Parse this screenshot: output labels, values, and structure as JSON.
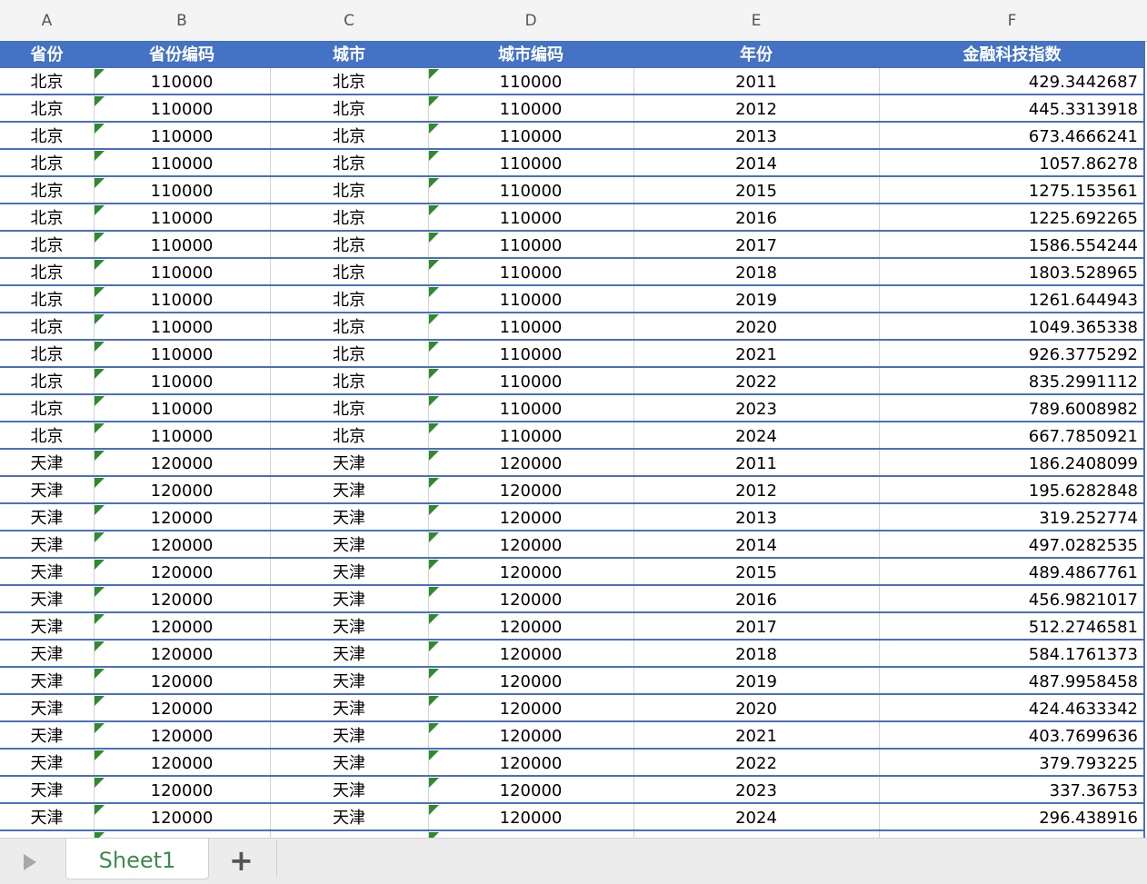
{
  "column_letters": [
    "A",
    "B",
    "C",
    "D",
    "E",
    "F"
  ],
  "headers": [
    "省份",
    "省份编码",
    "城市",
    "城市编码",
    "年份",
    "金融科技指数"
  ],
  "rows": [
    [
      "北京",
      "110000",
      "北京",
      "110000",
      "2011",
      "429.3442687"
    ],
    [
      "北京",
      "110000",
      "北京",
      "110000",
      "2012",
      "445.3313918"
    ],
    [
      "北京",
      "110000",
      "北京",
      "110000",
      "2013",
      "673.4666241"
    ],
    [
      "北京",
      "110000",
      "北京",
      "110000",
      "2014",
      "1057.86278"
    ],
    [
      "北京",
      "110000",
      "北京",
      "110000",
      "2015",
      "1275.153561"
    ],
    [
      "北京",
      "110000",
      "北京",
      "110000",
      "2016",
      "1225.692265"
    ],
    [
      "北京",
      "110000",
      "北京",
      "110000",
      "2017",
      "1586.554244"
    ],
    [
      "北京",
      "110000",
      "北京",
      "110000",
      "2018",
      "1803.528965"
    ],
    [
      "北京",
      "110000",
      "北京",
      "110000",
      "2019",
      "1261.644943"
    ],
    [
      "北京",
      "110000",
      "北京",
      "110000",
      "2020",
      "1049.365338"
    ],
    [
      "北京",
      "110000",
      "北京",
      "110000",
      "2021",
      "926.3775292"
    ],
    [
      "北京",
      "110000",
      "北京",
      "110000",
      "2022",
      "835.2991112"
    ],
    [
      "北京",
      "110000",
      "北京",
      "110000",
      "2023",
      "789.6008982"
    ],
    [
      "北京",
      "110000",
      "北京",
      "110000",
      "2024",
      "667.7850921"
    ],
    [
      "天津",
      "120000",
      "天津",
      "120000",
      "2011",
      "186.2408099"
    ],
    [
      "天津",
      "120000",
      "天津",
      "120000",
      "2012",
      "195.6282848"
    ],
    [
      "天津",
      "120000",
      "天津",
      "120000",
      "2013",
      "319.252774"
    ],
    [
      "天津",
      "120000",
      "天津",
      "120000",
      "2014",
      "497.0282535"
    ],
    [
      "天津",
      "120000",
      "天津",
      "120000",
      "2015",
      "489.4867761"
    ],
    [
      "天津",
      "120000",
      "天津",
      "120000",
      "2016",
      "456.9821017"
    ],
    [
      "天津",
      "120000",
      "天津",
      "120000",
      "2017",
      "512.2746581"
    ],
    [
      "天津",
      "120000",
      "天津",
      "120000",
      "2018",
      "584.1761373"
    ],
    [
      "天津",
      "120000",
      "天津",
      "120000",
      "2019",
      "487.9958458"
    ],
    [
      "天津",
      "120000",
      "天津",
      "120000",
      "2020",
      "424.4633342"
    ],
    [
      "天津",
      "120000",
      "天津",
      "120000",
      "2021",
      "403.7699636"
    ],
    [
      "天津",
      "120000",
      "天津",
      "120000",
      "2022",
      "379.793225"
    ],
    [
      "天津",
      "120000",
      "天津",
      "120000",
      "2023",
      "337.36753"
    ],
    [
      "天津",
      "120000",
      "天津",
      "120000",
      "2024",
      "296.438916"
    ]
  ],
  "tabs": {
    "sheet": "Sheet1",
    "add": "+"
  },
  "colors": {
    "header_bg": "#4472c4",
    "row_border": "#4a6fc0",
    "tab_text": "#3f8a4f"
  }
}
